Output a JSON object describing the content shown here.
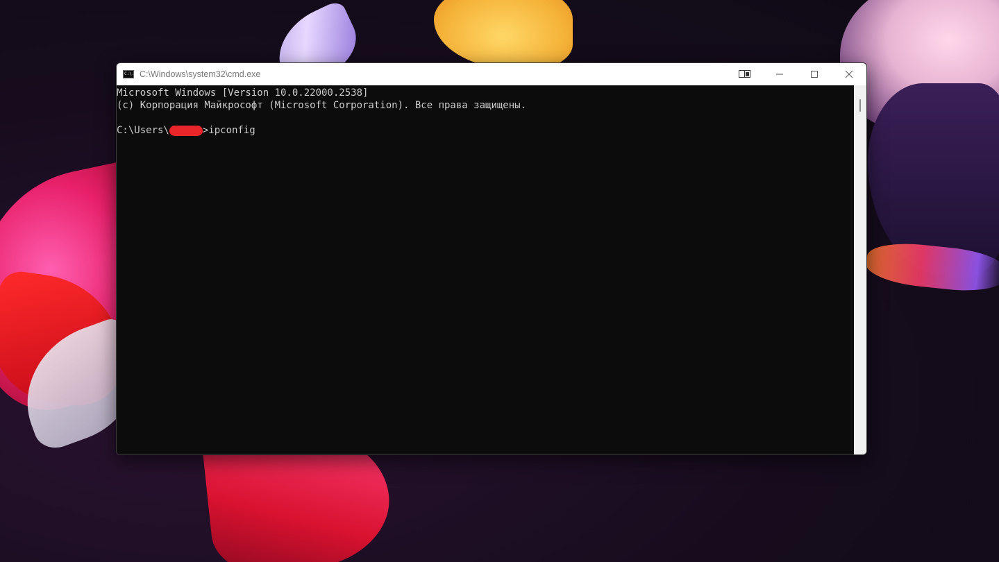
{
  "window": {
    "title": "C:\\Windows\\system32\\cmd.exe",
    "icon": "console-icon",
    "buttons": [
      "snap-icon",
      "minimize-icon",
      "maximize-icon",
      "close-icon"
    ]
  },
  "console": {
    "line1": "Microsoft Windows [Version 10.0.22000.2538]",
    "line2": "(c) Корпорация Майкрософт (Microsoft Corporation). Все права защищены.",
    "prompt_prefix": "C:\\Users\\",
    "prompt_suffix": ">ipconfig"
  },
  "colors": {
    "console_bg": "#0c0c0c",
    "console_text": "#cccccc",
    "titlebar_bg": "#ffffff",
    "redaction": "#e8262a"
  }
}
